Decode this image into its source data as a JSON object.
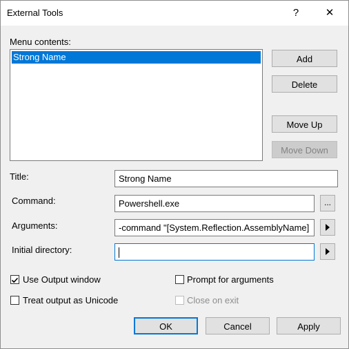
{
  "window": {
    "title": "External Tools",
    "help_glyph": "?",
    "close_glyph": "✕"
  },
  "menu_contents": {
    "label": "Menu contents:",
    "items": [
      "Strong Name"
    ],
    "selected_index": 0
  },
  "side_buttons": {
    "add": "Add",
    "delete": "Delete",
    "move_up": "Move Up",
    "move_down": "Move Down"
  },
  "fields": {
    "title_label": "Title:",
    "title_value": "Strong Name",
    "command_label": "Command:",
    "command_value": "Powershell.exe",
    "browse_label": "...",
    "arguments_label": "Arguments:",
    "arguments_value": "-command \"[System.Reflection.AssemblyName]",
    "initial_dir_label": "Initial directory:",
    "initial_dir_value": ""
  },
  "options": {
    "use_output_window": {
      "label": "Use Output window",
      "checked": true
    },
    "prompt_for_arguments": {
      "label": "Prompt for arguments",
      "checked": false
    },
    "treat_output_unicode": {
      "label": "Treat output as Unicode",
      "checked": false
    },
    "close_on_exit": {
      "label": "Close on exit",
      "checked": false,
      "disabled": true
    }
  },
  "footer": {
    "ok": "OK",
    "cancel": "Cancel",
    "apply": "Apply"
  },
  "colors": {
    "accent": "#0078d7",
    "dialog_bg": "#f0f0f0"
  }
}
